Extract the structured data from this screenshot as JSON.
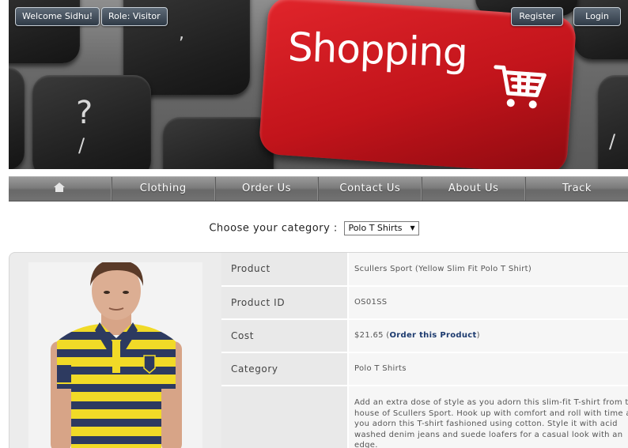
{
  "header": {
    "welcome_label": "Welcome Sidhu!",
    "role_label": "Role: Visitor",
    "register_label": "Register",
    "login_label": "Login",
    "banner_key_text": "Shopping",
    "banner_key_icon": "shopping-cart-icon",
    "banner_key_color": "#c8161d"
  },
  "nav": {
    "home_icon": "home-icon",
    "items": [
      "Clothing",
      "Order Us",
      "Contact Us",
      "About Us",
      "Track"
    ]
  },
  "category": {
    "label": "Choose your category :",
    "selected": "Polo T Shirts"
  },
  "product": {
    "rows": [
      {
        "label": "Product",
        "value": "Scullers Sport (Yellow Slim Fit Polo T Shirt)"
      },
      {
        "label": "Product ID",
        "value": "OS01SS"
      },
      {
        "label": "Cost",
        "price": "$21.65",
        "link_open": "(",
        "link_text": "Order this Product",
        "link_close": ")"
      },
      {
        "label": "Category",
        "value": "Polo T Shirts"
      },
      {
        "label": "",
        "value": "Add an extra dose of style as you adorn this slim-fit T-shirt from the house of Scullers Sport. Hook up with comfort and roll with time as you adorn this T-shirt fashioned using cotton. Style it with acid washed denim jeans and suede loafers for a casual look with an edge."
      }
    ]
  }
}
